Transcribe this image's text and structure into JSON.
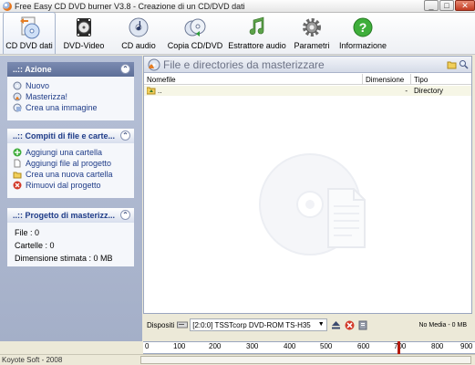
{
  "window": {
    "title": "Free Easy CD DVD burner V3.8 - Creazione di un CD/DVD dati"
  },
  "window_controls": {
    "minimize": "_",
    "maximize": "□",
    "close": "✕"
  },
  "toolbar": {
    "items": [
      {
        "label": "CD DVD dati",
        "icon": "data-disc-icon",
        "active": true
      },
      {
        "label": "DVD-Video",
        "icon": "film-icon"
      },
      {
        "label": "CD audio",
        "icon": "audio-cd-icon"
      },
      {
        "label": "Copia CD/DVD",
        "icon": "copy-disc-icon"
      },
      {
        "label": "Estrattore audio",
        "icon": "music-note-icon"
      },
      {
        "label": "Parametri",
        "icon": "gear-icon"
      },
      {
        "label": "Informazione",
        "icon": "help-icon"
      }
    ]
  },
  "left_panel": {
    "azione": {
      "title": "..:: Azione",
      "items": [
        "Nuovo",
        "Masterizza!",
        "Crea una immagine"
      ]
    },
    "compiti": {
      "title": "..:: Compiti di file e carte...",
      "items": [
        "Aggiungi una cartella",
        "Aggiungi file al progetto",
        "Crea una nuova cartella",
        "Rimuovi dal progetto"
      ]
    },
    "progetto": {
      "title": "..:: Progetto di masterizz...",
      "file": "File : 0",
      "cartelle": "Cartelle : 0",
      "dimensione": "Dimensione stimata : 0 MB"
    }
  },
  "file_panel": {
    "title": "File e directories da masterizzare",
    "columns": [
      "Nomefile",
      "Dimensione",
      "Tipo"
    ],
    "rows": [
      {
        "name": "..",
        "size": "-",
        "type": "Directory"
      }
    ]
  },
  "device_bar": {
    "label": "Dispositi",
    "selected_device": "[2:0:0] TSSTcorp DVD-ROM TS-H35",
    "dropdown_arrow": "▼",
    "media_status": "No Media - 0 MB"
  },
  "ruler": {
    "ticks": [
      "0",
      "100",
      "200",
      "300",
      "400",
      "500",
      "600",
      "700",
      "800",
      "900"
    ]
  },
  "status_bar": {
    "left": "Koyote Soft - 2008"
  },
  "colors": {
    "accent": "#1f3c88",
    "header": "#5e6f98",
    "marker": "#b51a10"
  }
}
